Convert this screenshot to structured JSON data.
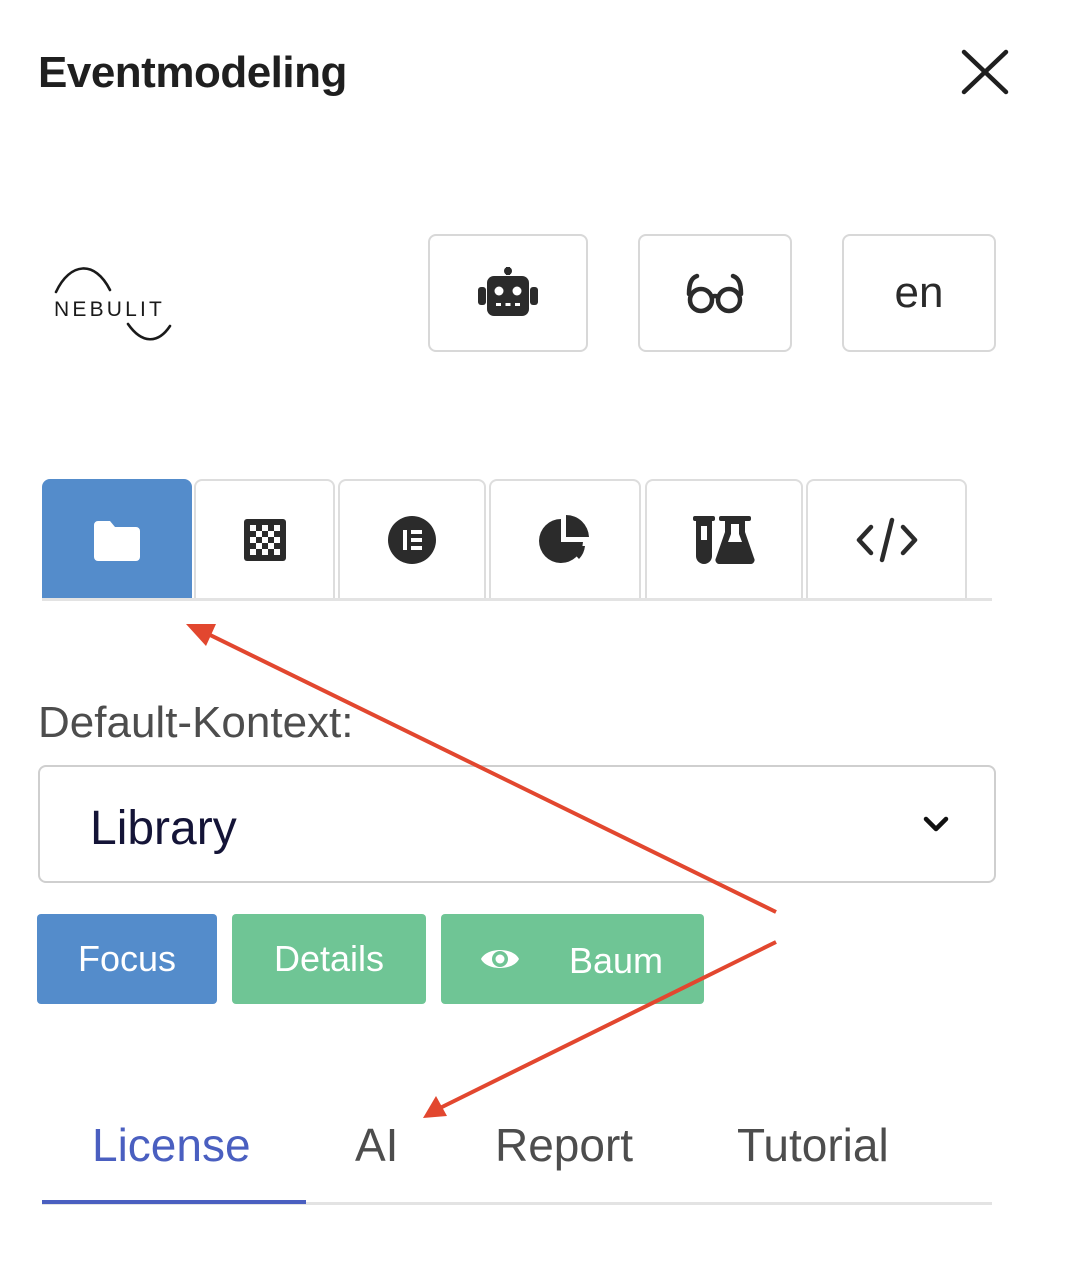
{
  "header": {
    "title": "Eventmodeling",
    "close_icon": "close-icon"
  },
  "brand": {
    "logo_text": "NEBULIT"
  },
  "toolbar": {
    "ai_icon": "robot-icon",
    "reading_icon": "glasses-icon",
    "language": "en"
  },
  "view_tabs": [
    {
      "icon": "folder-icon",
      "active": true
    },
    {
      "icon": "checkerboard-icon",
      "active": false
    },
    {
      "icon": "elementor-icon",
      "active": false
    },
    {
      "icon": "pie-chart-icon",
      "active": false
    },
    {
      "icon": "flask-icon",
      "active": false
    },
    {
      "icon": "code-icon",
      "active": false
    }
  ],
  "context": {
    "label": "Default-Kontext:",
    "selected": "Library"
  },
  "actions": {
    "focus": "Focus",
    "details": "Details",
    "baum": "Baum"
  },
  "bottom_tabs": {
    "items": [
      "License",
      "AI",
      "Report",
      "Tutorial"
    ],
    "active": "License"
  },
  "colors": {
    "primary_blue": "#548ccb",
    "success_green": "#6fc595",
    "tab_active": "#4a5fc0",
    "annotation_red": "#e2472f"
  }
}
